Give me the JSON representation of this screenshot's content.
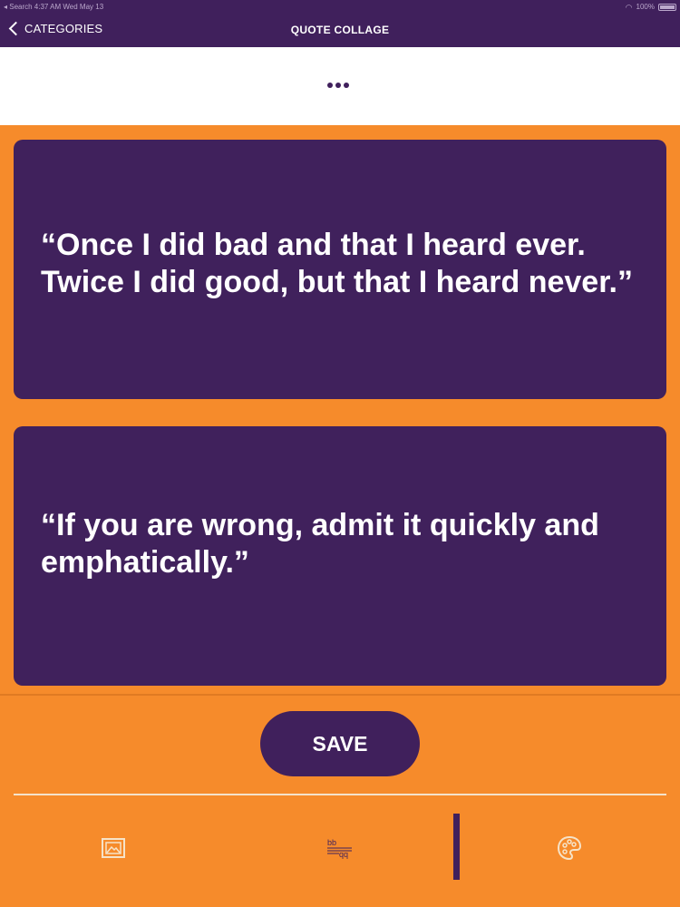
{
  "status_bar": {
    "left": "◂ Search   4:37 AM   Wed May 13",
    "battery": "100%"
  },
  "nav": {
    "back_label": "CATEGORIES",
    "title": "QUOTE COLLAGE"
  },
  "menu": {
    "icon": "more-dots-icon"
  },
  "quotes": [
    {
      "text": "“Once I did bad and that I heard ever. Twice I did good, but that I heard never.”"
    },
    {
      "text": "“If you are wrong, admit it quickly and emphatically.”"
    }
  ],
  "actions": {
    "save_label": "SAVE"
  },
  "toolbar": {
    "tabs": [
      {
        "icon": "image-icon"
      },
      {
        "icon": "text-style-icon",
        "glyph": "bb qq"
      },
      {
        "icon": "palette-icon"
      }
    ],
    "active_index": 1
  },
  "colors": {
    "primary": "#40205c",
    "background": "#f68b2b",
    "card": "#40215c",
    "text_on_primary": "#ffffff"
  }
}
